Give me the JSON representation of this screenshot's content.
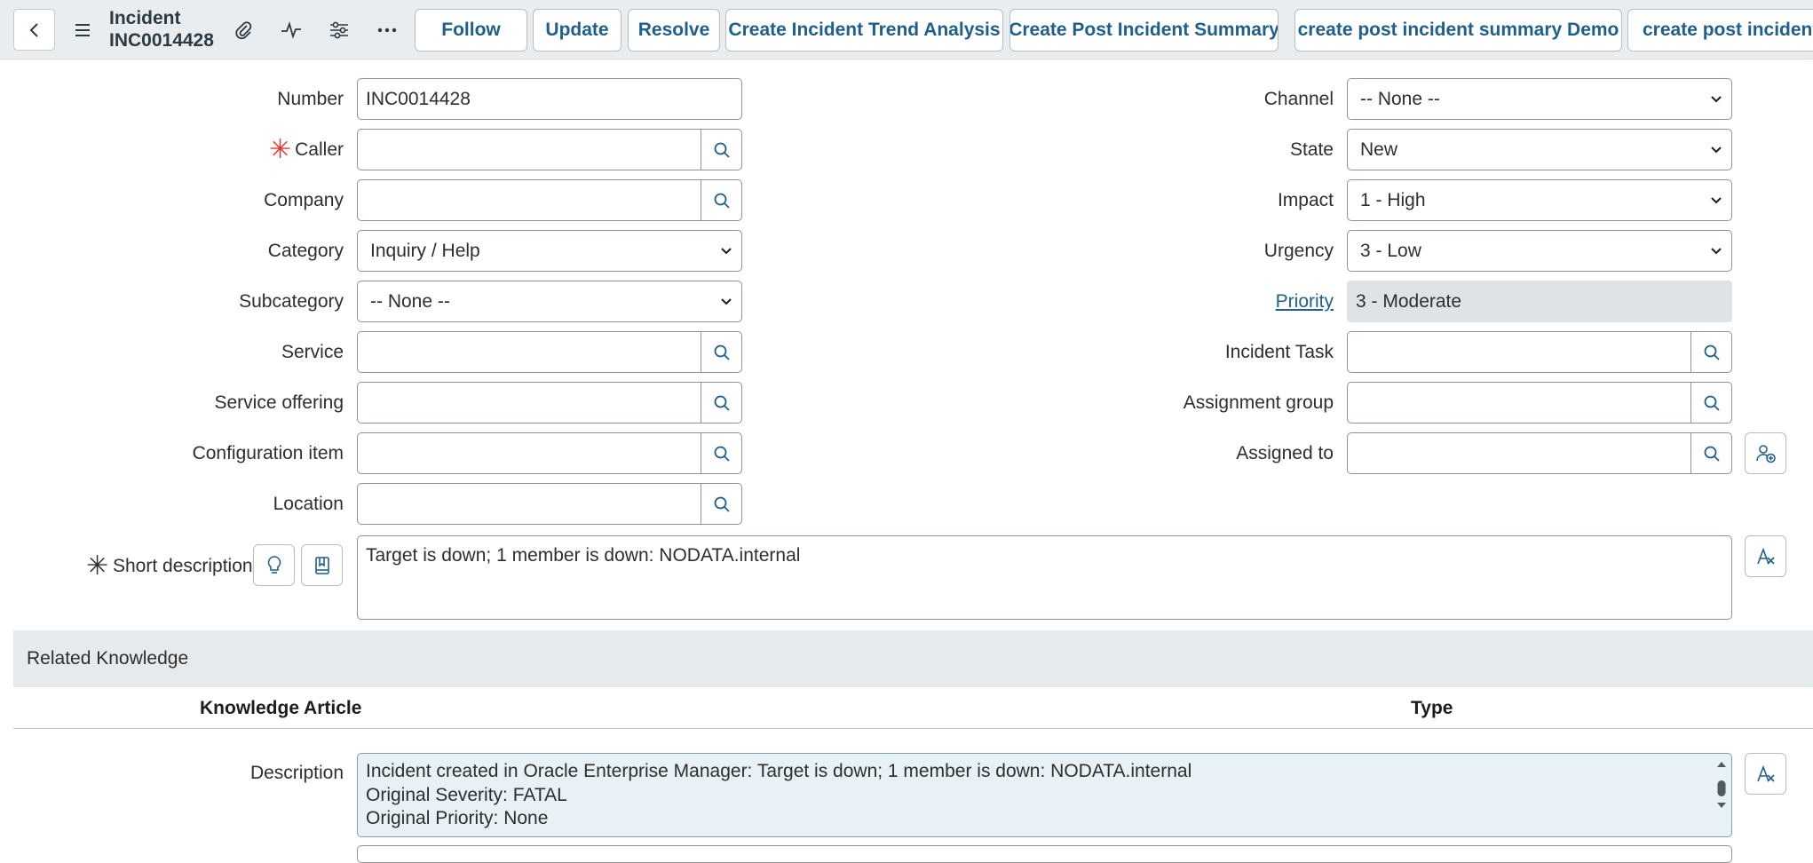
{
  "header": {
    "title_line1": "Incident",
    "title_line2": "INC0014428",
    "buttons": [
      "Follow",
      "Update",
      "Resolve",
      "Create Incident Trend Analysis",
      "Create Post Incident Summary",
      "create post incident summary Demo",
      "create post incident s"
    ],
    "icons": [
      "chevron-left-icon",
      "menu-icon",
      "paperclip-icon",
      "activity-icon",
      "sliders-icon",
      "more-icon"
    ]
  },
  "form": {
    "number": {
      "label": "Number",
      "value": "INC0014428"
    },
    "caller": {
      "label": "Caller",
      "value": ""
    },
    "company": {
      "label": "Company",
      "value": ""
    },
    "category": {
      "label": "Category",
      "value": "Inquiry / Help"
    },
    "subcategory": {
      "label": "Subcategory",
      "value": "-- None --"
    },
    "service": {
      "label": "Service",
      "value": ""
    },
    "service_offering": {
      "label": "Service offering",
      "value": ""
    },
    "configuration_item": {
      "label": "Configuration item",
      "value": ""
    },
    "location": {
      "label": "Location",
      "value": ""
    },
    "channel": {
      "label": "Channel",
      "value": "-- None --"
    },
    "state": {
      "label": "State",
      "value": "New"
    },
    "impact": {
      "label": "Impact",
      "value": "1 - High"
    },
    "urgency": {
      "label": "Urgency",
      "value": "3 - Low"
    },
    "priority": {
      "label": "Priority",
      "value": "3 - Moderate"
    },
    "incident_task": {
      "label": "Incident Task",
      "value": ""
    },
    "assignment_group": {
      "label": "Assignment group",
      "value": ""
    },
    "assigned_to": {
      "label": "Assigned to",
      "value": ""
    },
    "short_description": {
      "label": "Short description",
      "value": "Target is down; 1 member is down: NODATA.internal"
    },
    "description": {
      "label": "Description",
      "lines": [
        "Incident created in Oracle Enterprise Manager: Target is down; 1 member is down: NODATA.internal",
        "Original Severity: FATAL",
        "Original Priority: None"
      ]
    }
  },
  "related_knowledge": {
    "title": "Related Knowledge",
    "columns": [
      "Knowledge Article",
      "Type"
    ]
  },
  "colors": {
    "accent": "#1f5f8b",
    "required": "#e53935",
    "header_bg": "#e9edef"
  }
}
